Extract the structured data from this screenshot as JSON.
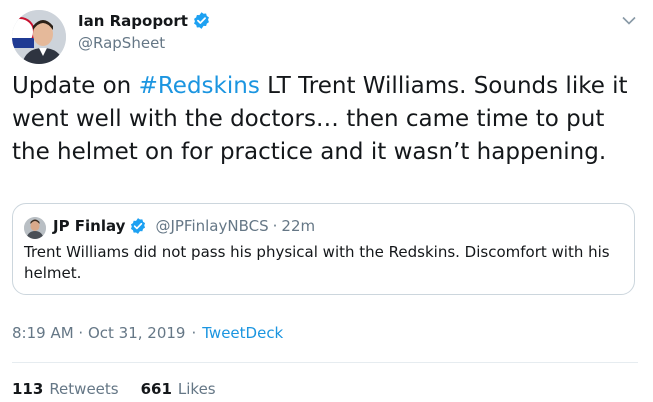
{
  "author": {
    "name": "Ian Rapoport",
    "handle": "@RapSheet"
  },
  "tweet": {
    "text_before": "Update on ",
    "hashtag": "#Redskins",
    "text_after": " LT Trent Williams. Sounds like it went well with the doctors… then came time to put the helmet on for practice and it wasn’t happening."
  },
  "quoted_tweet": {
    "name": "JP Finlay",
    "handle": "@JPFinlayNBCS",
    "separator": "·",
    "time": "22m",
    "text": "Trent Williams did not pass his physical with the Redskins. Discomfort with his helmet."
  },
  "meta": {
    "timestamp": "8:19 AM · Oct 31, 2019",
    "separator": "·",
    "source": "TweetDeck"
  },
  "stats": {
    "retweets_count": "113",
    "retweets_label": "Retweets",
    "likes_count": "661",
    "likes_label": "Likes"
  },
  "colors": {
    "link": "#1b95e0",
    "verified": "#1da1f2",
    "secondary_text": "#657786",
    "border": "#ccd6dd"
  },
  "icons": {
    "verified": "verified-badge-icon",
    "caret": "chevron-down-icon"
  }
}
